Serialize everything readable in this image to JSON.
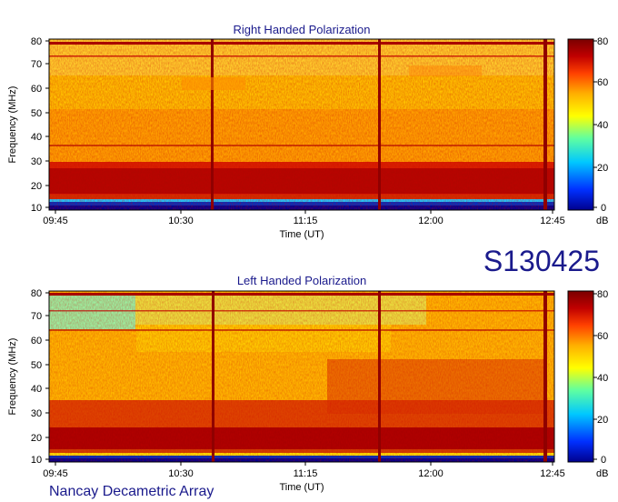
{
  "chart_data": [
    {
      "type": "heatmap",
      "title": "Right Handed Polarization",
      "xlabel": "Time (UT)",
      "ylabel": "Frequency (MHz)",
      "x_ticks": [
        "09:45",
        "10:30",
        "11:15",
        "12:00",
        "12:45"
      ],
      "y_ticks": [
        "10",
        "20",
        "30",
        "40",
        "50",
        "60",
        "70",
        "80"
      ],
      "ylim": [
        10,
        80
      ],
      "colorbar": {
        "ticks": [
          "0",
          "20",
          "40",
          "60",
          "80"
        ],
        "unit": "dB",
        "range": [
          0,
          80
        ]
      }
    },
    {
      "type": "heatmap",
      "title": "Left Handed Polarization",
      "xlabel": "Time (UT)",
      "ylabel": "Frequency (MHz)",
      "x_ticks": [
        "09:45",
        "10:30",
        "11:15",
        "12:00",
        "12:45"
      ],
      "y_ticks": [
        "10",
        "20",
        "30",
        "40",
        "50",
        "60",
        "70",
        "80"
      ],
      "ylim": [
        10,
        80
      ],
      "colorbar": {
        "ticks": [
          "0",
          "20",
          "40",
          "60",
          "80"
        ],
        "unit": "dB",
        "range": [
          0,
          80
        ]
      }
    }
  ],
  "observation_id": "S130425",
  "instrument": "Nancay Decametric Array",
  "colors": {
    "label_navy": "#1a1a8c",
    "colormap": [
      "#00008f",
      "#0050ff",
      "#00e0ff",
      "#80ff80",
      "#ffff00",
      "#ffb000",
      "#ff5000",
      "#c00000",
      "#800000"
    ]
  }
}
